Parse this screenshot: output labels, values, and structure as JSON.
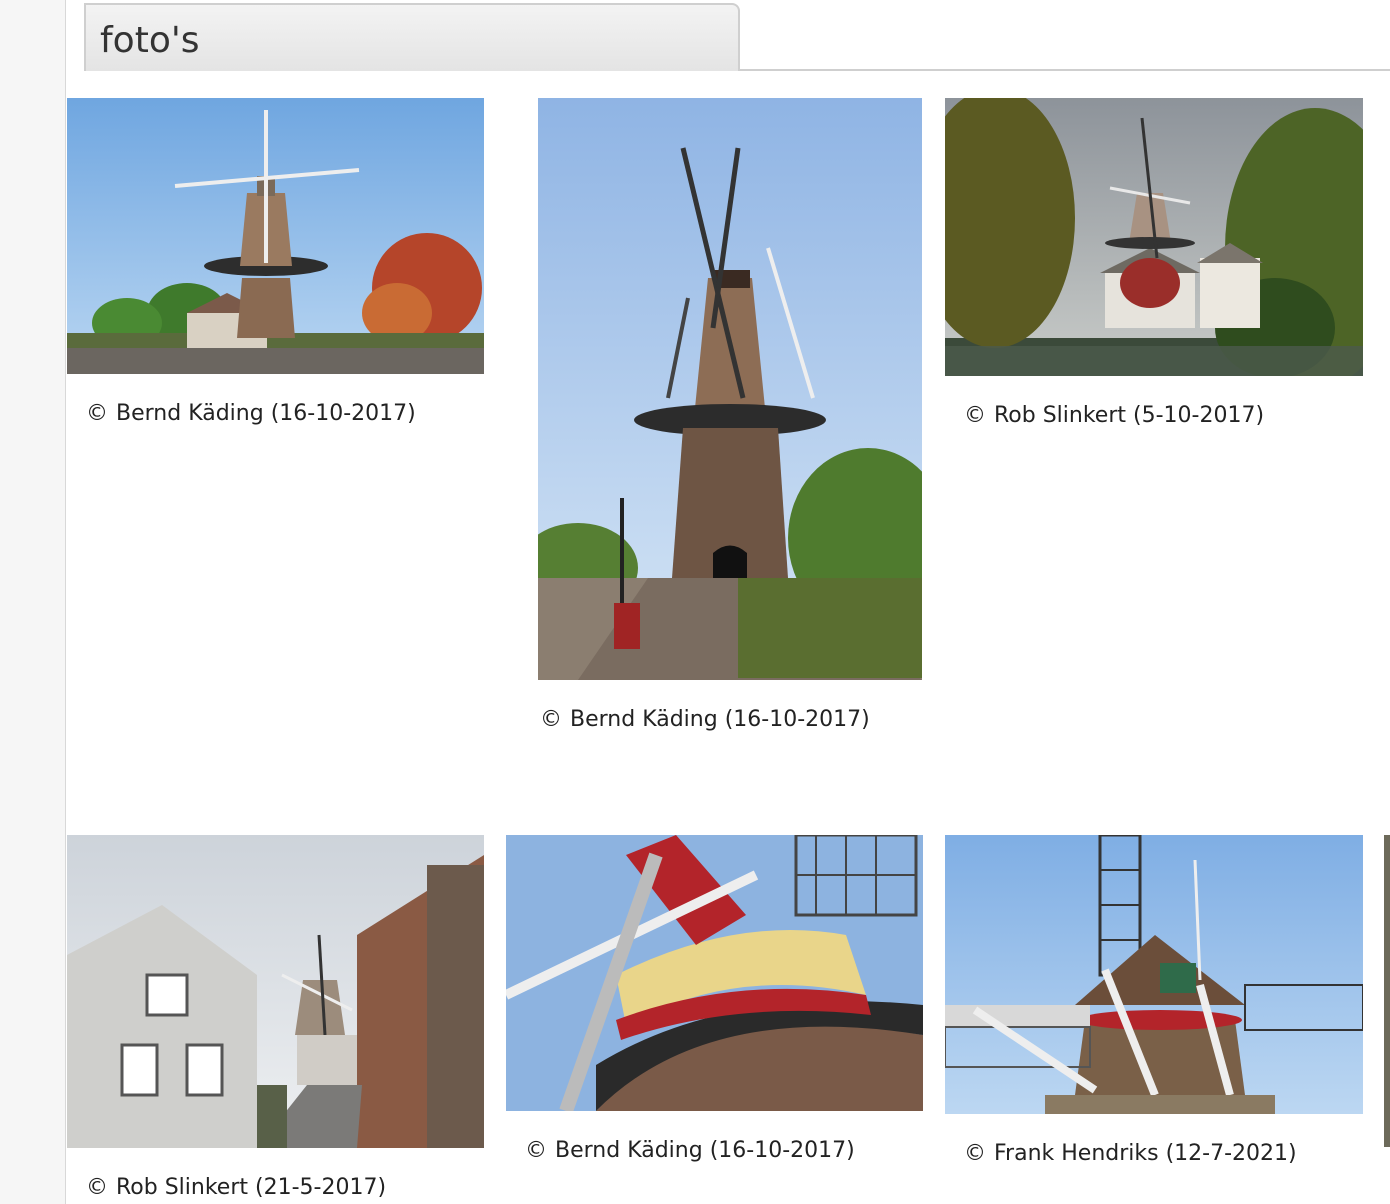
{
  "section": {
    "tab_label": "foto's"
  },
  "photos": [
    {
      "subject": "windmill-cemetery",
      "copyright_symbol": "©",
      "credit": "Bernd Käding (16-10-2017)"
    },
    {
      "subject": "windmill-street-portrait",
      "copyright_symbol": "©",
      "credit": "Bernd Käding (16-10-2017)"
    },
    {
      "subject": "windmill-waterfront",
      "copyright_symbol": "©",
      "credit": "Rob Slinkert (5-10-2017)"
    },
    {
      "subject": "street-with-windmill",
      "copyright_symbol": "©",
      "credit": "Rob Slinkert (21-5-2017)"
    },
    {
      "subject": "windmill-cap-closeup",
      "copyright_symbol": "©",
      "credit": "Bernd Käding (16-10-2017)"
    },
    {
      "subject": "windmill-cap-sails",
      "copyright_symbol": "©",
      "credit": "Frank Hendriks (12-7-2021)"
    }
  ]
}
